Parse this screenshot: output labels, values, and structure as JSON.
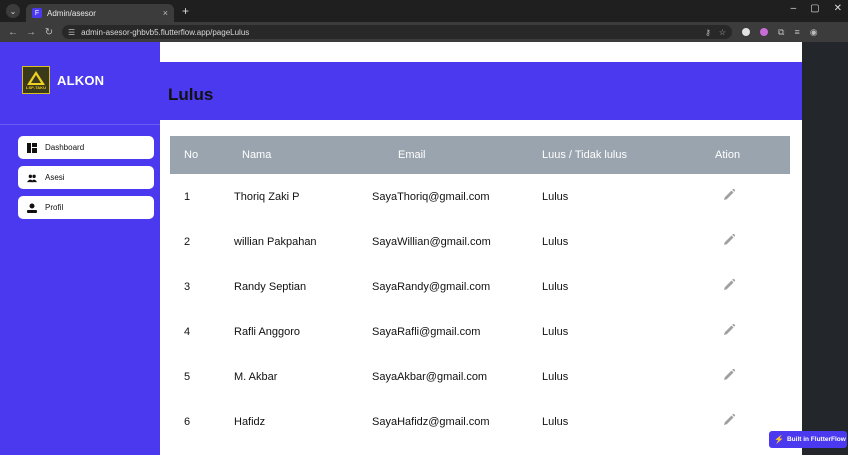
{
  "browser": {
    "tab_title": "Admin/asesor",
    "tab_close": "×",
    "new_tab": "+",
    "url": "admin-asesor-ghbvb5.flutterflow.app/pageLulus",
    "win_min": "–",
    "win_max": "▢",
    "win_close": "✕"
  },
  "sidebar": {
    "brand": "ALKON",
    "logo_text": "LSP-TAKU",
    "items": [
      {
        "label": "Dashboard",
        "icon": "dashboard-icon"
      },
      {
        "label": "Asesi",
        "icon": "group-icon"
      },
      {
        "label": "Profil",
        "icon": "person-icon"
      }
    ]
  },
  "main": {
    "title": "Lulus"
  },
  "table": {
    "headers": {
      "no": "No",
      "nama": "Nama",
      "email": "Email",
      "status": "Luus / Tidak lulus",
      "action": "Ation"
    },
    "rows": [
      {
        "no": "1",
        "nama": "Thoriq Zaki P",
        "email": "SayaThoriq@gmail.com",
        "status": "Lulus"
      },
      {
        "no": "2",
        "nama": "willian Pakpahan",
        "email": "SayaWillian@gmail.com",
        "status": "Lulus"
      },
      {
        "no": "3",
        "nama": "Randy Septian",
        "email": "SayaRandy@gmail.com",
        "status": "Lulus"
      },
      {
        "no": "4",
        "nama": "Rafli Anggoro",
        "email": "SayaRafli@gmail.com",
        "status": "Lulus"
      },
      {
        "no": "5",
        "nama": "M. Akbar",
        "email": "SayaAkbar@gmail.com",
        "status": "Lulus"
      },
      {
        "no": "6",
        "nama": "Hafidz",
        "email": "SayaHafidz@gmail.com",
        "status": "Lulus"
      }
    ]
  },
  "badge": {
    "text": "Built in FlutterFlow"
  },
  "colors": {
    "accent": "#4b39ef",
    "table_header": "#9aa4ae",
    "edit_icon": "#a0a0a0"
  }
}
